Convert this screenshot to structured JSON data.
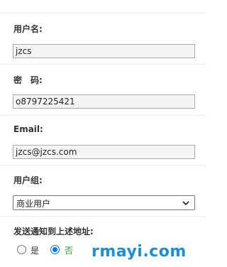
{
  "username": {
    "label": "用户名:",
    "value": "jzcs"
  },
  "password": {
    "label": "密　码:",
    "value": "o8797225421"
  },
  "email": {
    "label": "Email:",
    "value": "jzcs@jzcs.com"
  },
  "user_group": {
    "label": "用户组:",
    "selected": "商业用户"
  },
  "notify": {
    "label": "发送通知到上述地址:",
    "options": [
      {
        "label": "是",
        "checked": false
      },
      {
        "label": "否",
        "checked": true
      }
    ]
  },
  "watermark": "rmayi.com",
  "colors": {
    "radio_accent": "#0075ff",
    "watermark": "#1a8fd8",
    "checked_label": "#2a9d2a"
  },
  "icons": {
    "select_arrow": "chevron-down-icon"
  }
}
